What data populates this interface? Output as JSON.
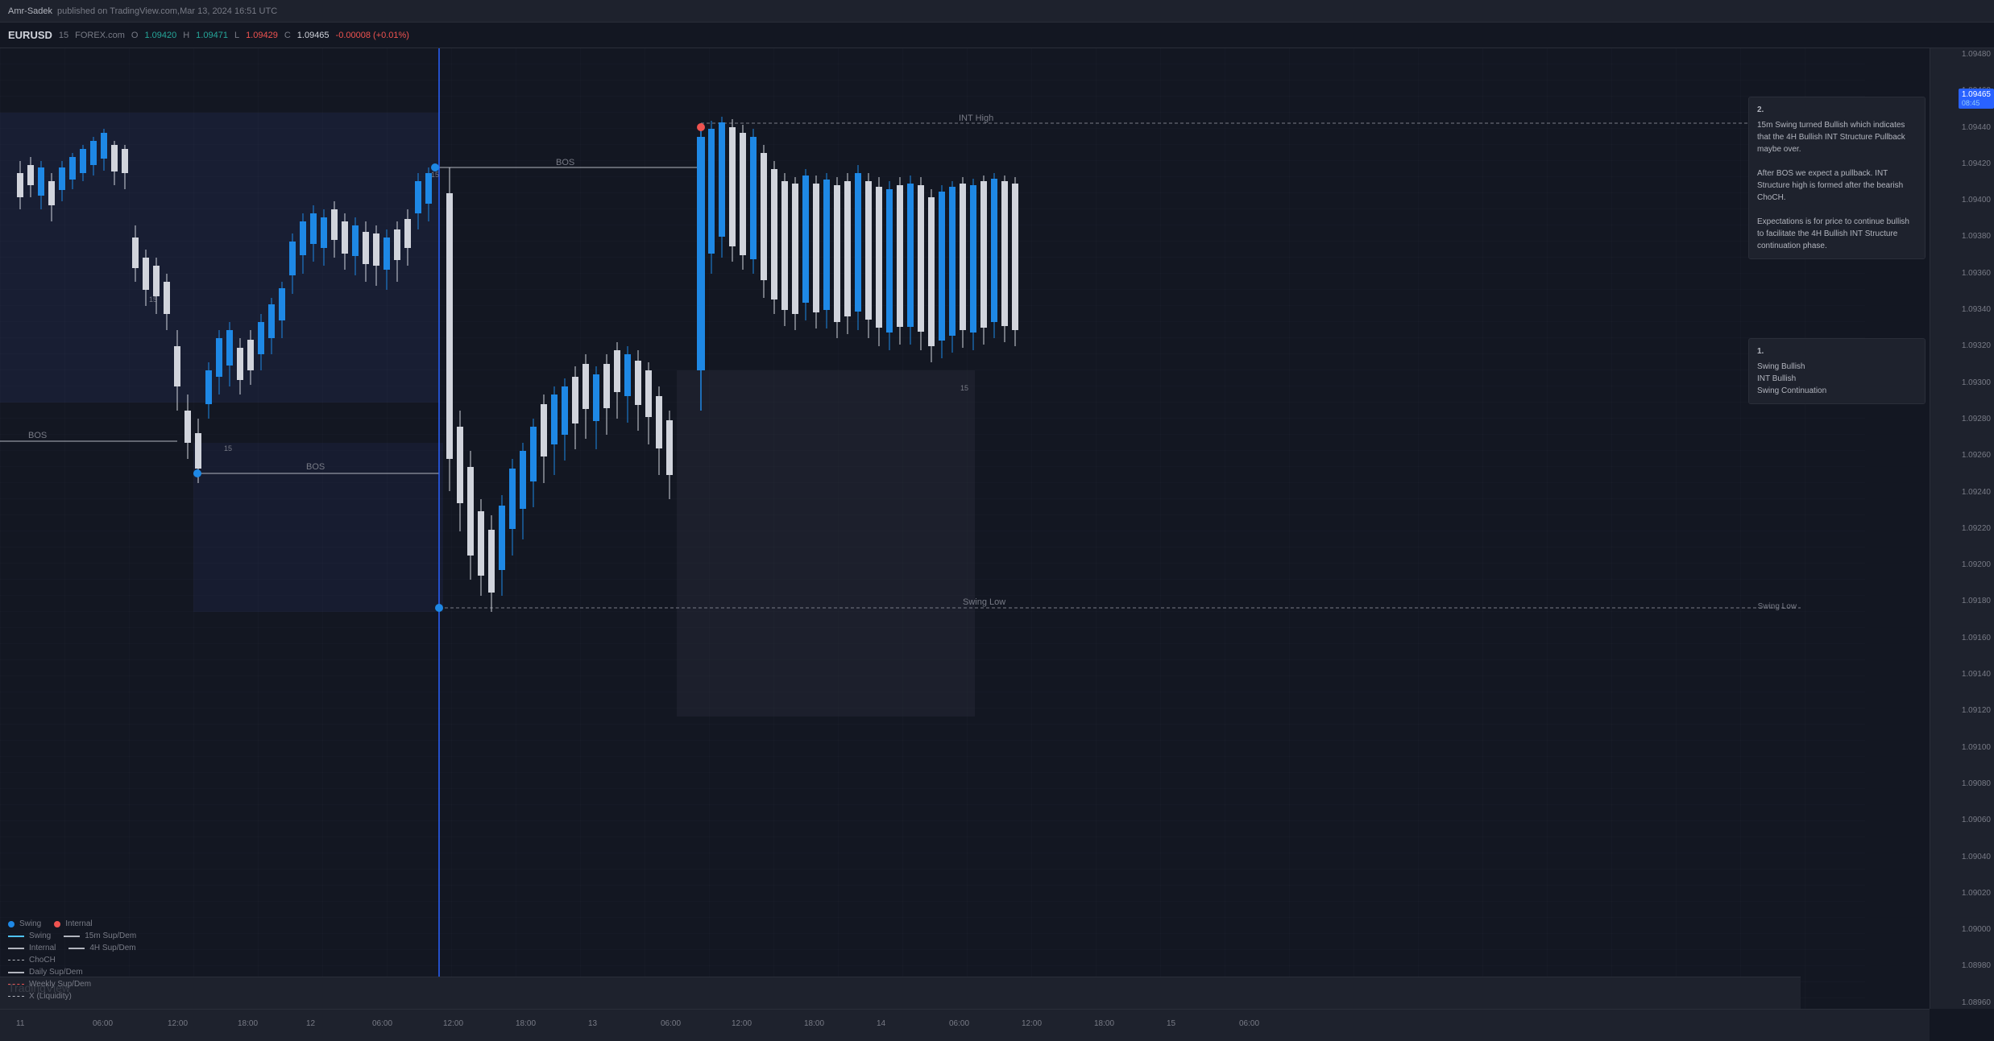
{
  "topbar": {
    "publisher": "Amr-Sadek",
    "platform": "published on TradingView.com,",
    "date": "Mar 13, 2024 16:51 UTC"
  },
  "symbolbar": {
    "symbol": "EURUSD",
    "timeframe": "15",
    "source": "FOREX.com",
    "open_label": "O",
    "open_value": "1.09420",
    "high_label": "H",
    "high_value": "1.09471",
    "low_label": "L",
    "low_value": "1.09429",
    "close_label": "C",
    "close_value": "1.09465",
    "change": "-0.00008 (+0.01%)"
  },
  "priceScale": {
    "prices": [
      "1.09480",
      "1.09460",
      "1.09440",
      "1.09420",
      "1.09400",
      "1.09380",
      "1.09360",
      "1.09340",
      "1.09320",
      "1.09300",
      "1.09280",
      "1.09260",
      "1.09240",
      "1.09220",
      "1.09200",
      "1.09180",
      "1.09160",
      "1.09140",
      "1.09120",
      "1.09100",
      "1.09080",
      "1.09060",
      "1.09040",
      "1.09020",
      "1.09000",
      "1.08980",
      "1.08960"
    ],
    "currentPrice": "1.09465"
  },
  "timeAxis": {
    "labels": [
      "11",
      "06:00",
      "12:00",
      "18:00",
      "12",
      "06:00",
      "12:00",
      "18:00",
      "13",
      "06:00",
      "12:00",
      "18:00",
      "14",
      "06:00",
      "12:00",
      "18:00",
      "15",
      "06:00"
    ]
  },
  "annotations": {
    "note1": {
      "number": "1.",
      "lines": [
        "Swing Bullish",
        "INT Bullish",
        "Swing Continuation"
      ]
    },
    "note2": {
      "number": "2.",
      "text": "15m Swing turned Bullish which indicates that the 4H Bullish INT Structure Pullback maybe over.\n\nAfter BOS we expect a pullback. INT Structure high is formed after the bearish ChoCH.\n\nExpectations is for price to continue bullish to facilitate the 4H Bullish INT Structure continuation phase."
    },
    "intHigh": "INT High",
    "swingLow": "Swing Low",
    "bos1": "BOS",
    "bos2": "BOS",
    "bos3": "BOS"
  },
  "legend": {
    "items": [
      {
        "type": "dot",
        "color": "#1e88e5",
        "label": "Swing"
      },
      {
        "type": "dot",
        "color": "#ef5350",
        "label": "Internal"
      },
      {
        "type": "line",
        "color": "#4fc3f7",
        "label": "Swing"
      },
      {
        "type": "line",
        "color": "#b2b5be",
        "label": "15m Sup/Dem"
      },
      {
        "type": "line",
        "color": "#b2b5be",
        "label": "Internal"
      },
      {
        "type": "line",
        "color": "#b2b5be",
        "label": "4H Sup/Dem"
      },
      {
        "type": "dashed",
        "color": "#b2b5be",
        "label": "ChoCH"
      },
      {
        "type": "line",
        "color": "#b2b5be",
        "label": "Daily Sup/Dem"
      },
      {
        "type": "dashed",
        "color": "#ef5350",
        "label": "Weekly Sup/Dem"
      },
      {
        "type": "dashed",
        "color": "#b2b5be",
        "label": "X (Liquidity)"
      }
    ]
  }
}
